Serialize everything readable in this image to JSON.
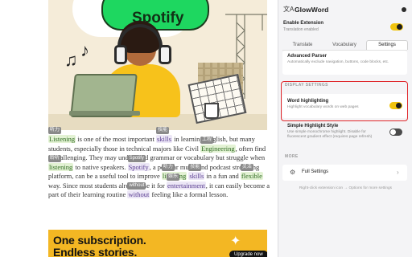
{
  "article": {
    "ad_brand_logo_text": "Spotify",
    "paragraph": {
      "w1": "Listening",
      "t1": "听力",
      "s1": " is one of the most important ",
      "w2": "skills",
      "t2": "技能",
      "s2": " in learning English, but many students, especially those in technical majors like Civil ",
      "w3": "Engineering",
      "t3": "工程",
      "s3": ", often find it challenging. They may understand grammar or vocabulary but struggle when ",
      "w4": "listening",
      "t4": "聆听",
      "s4": " to native speakers. ",
      "w5": "Spotify",
      "t5": "Spotify",
      "s5": ", a popular music and podcast streaming platform, can be a useful tool to improve ",
      "w6": "listening",
      "t6": "听力",
      "s6": " ",
      "w7": "skills",
      "t7": "技能",
      "s7": " in a fun and ",
      "w8": "flexible",
      "t8": "灵活",
      "s8": " way. Since most students already use it for ",
      "w9": "entertainment",
      "t9": "娱乐",
      "s9": ", it can easily become a part of their learning routine ",
      "w10": "without",
      "t10": "without",
      "s10": " feeling like a formal lesson."
    },
    "ad": {
      "line1": "One subscription.",
      "line2": "Endless stories.",
      "cta": "Upgrade now"
    }
  },
  "extension": {
    "title": "GlowWord",
    "enable": {
      "label": "Enable Extension",
      "sub": "Translation enabled",
      "on": true
    },
    "tabs": [
      "Translate",
      "Vocabulary",
      "Settings"
    ],
    "active_tab": "Settings",
    "advanced_parser": {
      "title": "Advanced Parser",
      "desc": "Automatically exclude navigation, buttons, code blocks, etc."
    },
    "display_settings_label": "DISPLAY SETTINGS",
    "word_highlighting": {
      "title": "Word highlighting",
      "desc": "Highlight vocabulary words on web pages",
      "on": true
    },
    "simple_highlight": {
      "title": "Simple Highlight Style",
      "desc": "Use simple monochrome highlight. Disable for fluorescent gradient effect (requires page refresh)",
      "on": false
    },
    "more_label": "MORE",
    "full_settings": "Full Settings",
    "footer": "Right-click extension icon → Options for more settings"
  },
  "colors": {
    "accent_yellow": "#f1c40f",
    "highlight_green": "#e3f2d4",
    "highlight_purple": "#ece7f6",
    "outline_red": "#e0262a"
  }
}
